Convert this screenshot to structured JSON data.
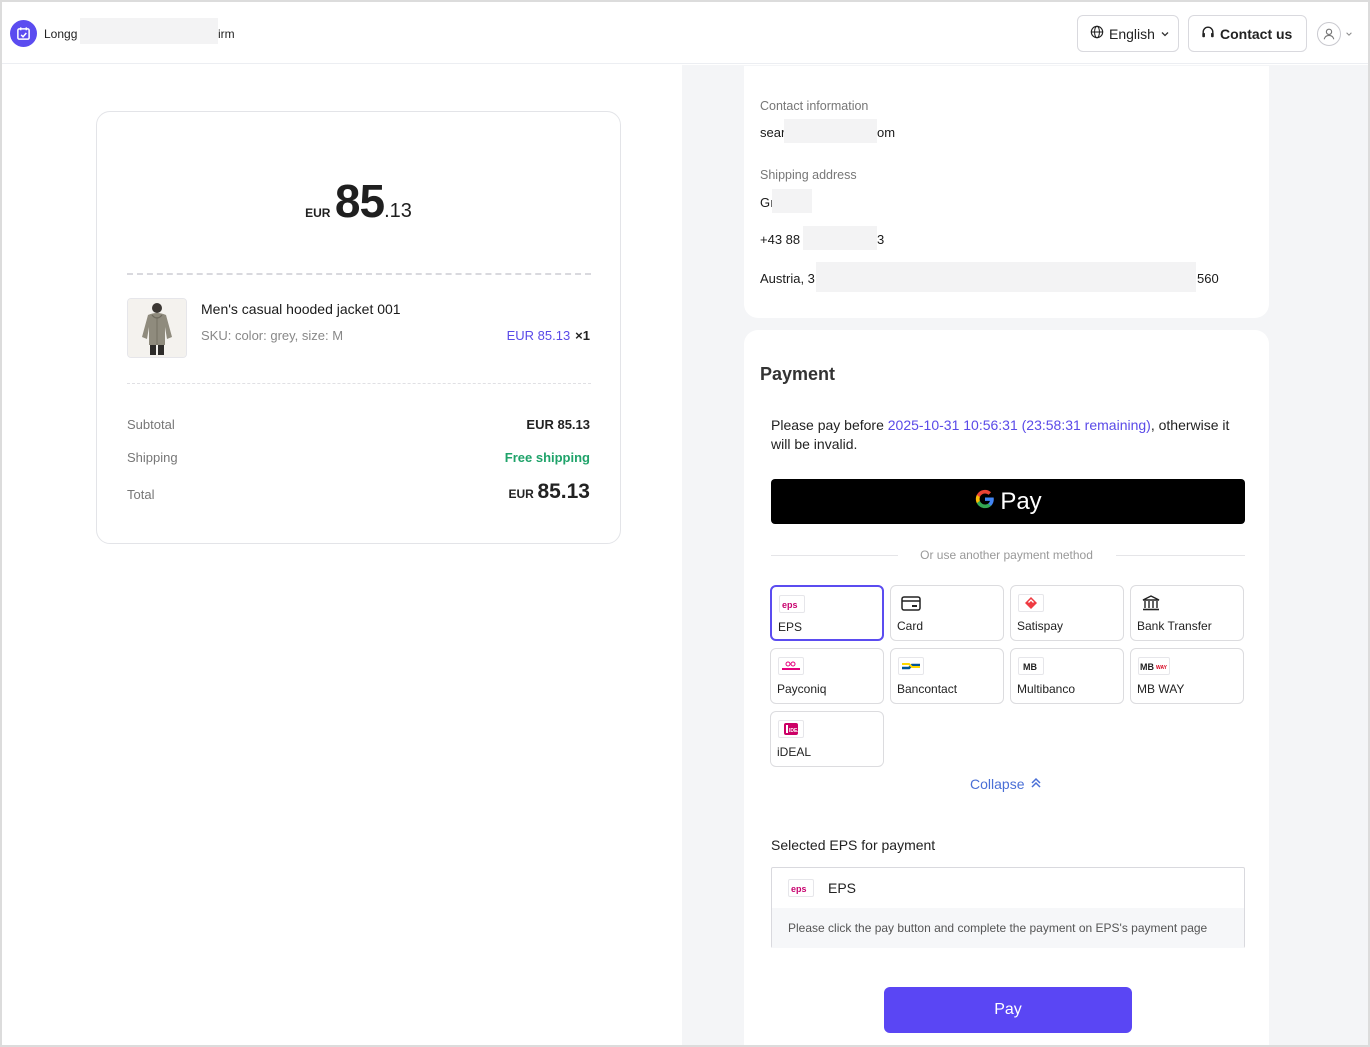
{
  "header": {
    "store_name_start": "Longg",
    "store_name_end": "irm",
    "language_label": "English",
    "contact_label": "Contact us"
  },
  "summary": {
    "currency": "EUR",
    "total_int": "85",
    "total_dec": ".13",
    "product": {
      "name": "Men's casual hooded jacket 001",
      "sku": "SKU: color: grey, size: M",
      "price": "EUR 85.13",
      "qty": "×1"
    },
    "subtotal_label": "Subtotal",
    "subtotal_value": "EUR 85.13",
    "shipping_label": "Shipping",
    "shipping_value": "Free shipping",
    "total_label": "Total",
    "total_value": "85.13"
  },
  "contact": {
    "contact_label": "Contact information",
    "email_start": "sear",
    "email_end": "om",
    "shipping_label": "Shipping address",
    "name_start": "Gı",
    "phone_start": "+43 88",
    "phone_end": "3",
    "address_start": "Austria, 3",
    "address_end": "560"
  },
  "payment": {
    "title": "Payment",
    "deadline_prefix": "Please pay before ",
    "deadline_highlight": "2025-10-31 10:56:31 (23:58:31 remaining)",
    "deadline_suffix": ", otherwise it will be invalid.",
    "gpay_label": "Pay",
    "or_text": "Or use another payment method",
    "methods": [
      {
        "name": "EPS"
      },
      {
        "name": "Card"
      },
      {
        "name": "Satispay"
      },
      {
        "name": "Bank Transfer"
      },
      {
        "name": "Payconiq"
      },
      {
        "name": "Bancontact"
      },
      {
        "name": "Multibanco"
      },
      {
        "name": "MB WAY"
      },
      {
        "name": "iDEAL"
      }
    ],
    "collapse_label": "Collapse",
    "selected_label": "Selected EPS  for payment",
    "selected_method": "EPS",
    "selected_hint": "Please click the pay button and complete the payment on EPS's payment page",
    "pay_button": "Pay"
  },
  "colors": {
    "accent": "#5b4cf0",
    "link": "#5a4ae8",
    "free_shipping": "#1fa36a"
  }
}
